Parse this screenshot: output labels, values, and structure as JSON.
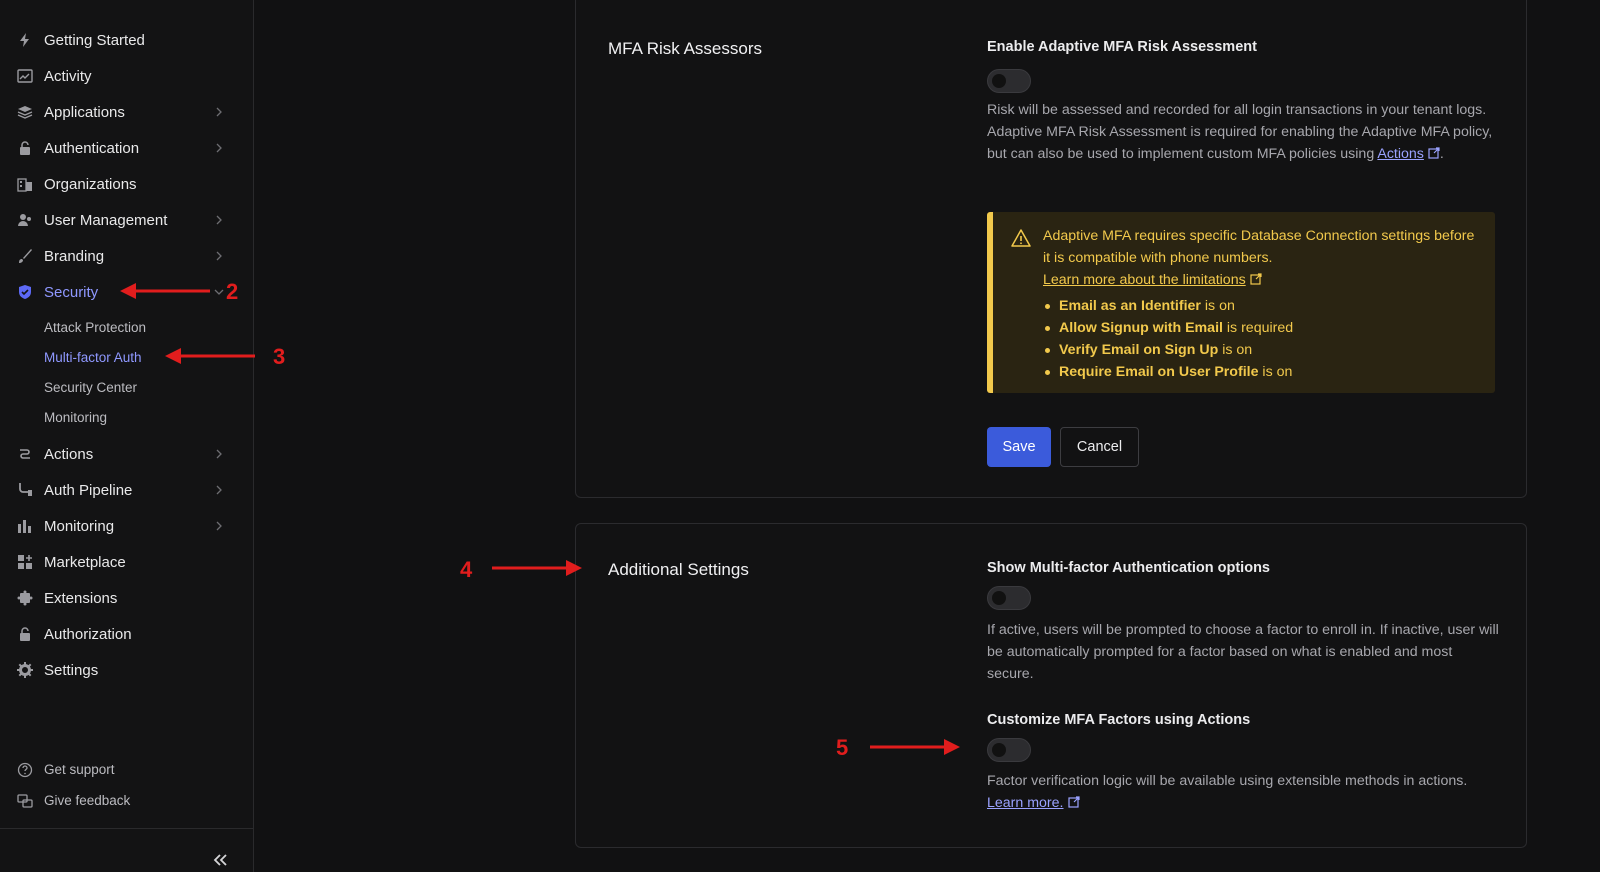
{
  "sidebar": {
    "items": [
      {
        "label": "Getting Started",
        "icon": "lightning-icon",
        "chevron": false
      },
      {
        "label": "Activity",
        "icon": "chart-line-icon",
        "chevron": false
      },
      {
        "label": "Applications",
        "icon": "layers-icon",
        "chevron": true
      },
      {
        "label": "Authentication",
        "icon": "lock-icon",
        "chevron": true
      },
      {
        "label": "Organizations",
        "icon": "building-icon",
        "chevron": false
      },
      {
        "label": "User Management",
        "icon": "users-icon",
        "chevron": true
      },
      {
        "label": "Branding",
        "icon": "brush-icon",
        "chevron": true
      },
      {
        "label": "Security",
        "icon": "shield-check-icon",
        "chevron": true,
        "active": true
      },
      {
        "label": "Actions",
        "icon": "actions-icon",
        "chevron": true
      },
      {
        "label": "Auth Pipeline",
        "icon": "pipeline-icon",
        "chevron": true
      },
      {
        "label": "Monitoring",
        "icon": "bar-chart-icon",
        "chevron": true
      },
      {
        "label": "Marketplace",
        "icon": "grid-plus-icon",
        "chevron": false
      },
      {
        "label": "Extensions",
        "icon": "puzzle-icon",
        "chevron": false
      },
      {
        "label": "Authorization",
        "icon": "lock-icon",
        "chevron": false
      },
      {
        "label": "Settings",
        "icon": "gear-icon",
        "chevron": false
      }
    ],
    "security_sub": [
      {
        "label": "Attack Protection"
      },
      {
        "label": "Multi-factor Auth",
        "active": true
      },
      {
        "label": "Security Center"
      },
      {
        "label": "Monitoring"
      }
    ],
    "bottom": [
      {
        "label": "Get support",
        "icon": "help-circle-icon"
      },
      {
        "label": "Give feedback",
        "icon": "feedback-icon"
      }
    ]
  },
  "risk_section": {
    "title": "MFA Risk Assessors",
    "toggle_label": "Enable Adaptive MFA Risk Assessment",
    "description": "Risk will be assessed and recorded for all login transactions in your tenant logs. Adaptive MFA Risk Assessment is required for enabling the Adaptive MFA policy, but can also be used to implement custom MFA policies using ",
    "link": "Actions",
    "alert": {
      "text": "Adaptive MFA requires specific Database Connection settings before it is compatible with phone numbers.",
      "link": "Learn more about the limitations",
      "items": [
        {
          "bold": "Email as an Identifier",
          "rest": " is on"
        },
        {
          "bold": "Allow Signup with Email",
          "rest": " is required"
        },
        {
          "bold": "Verify Email on Sign Up",
          "rest": " is on"
        },
        {
          "bold": "Require Email on User Profile",
          "rest": " is on"
        }
      ]
    },
    "save": "Save",
    "cancel": "Cancel"
  },
  "additional": {
    "title": "Additional Settings",
    "show_label": "Show Multi-factor Authentication options",
    "show_desc": "If active, users will be prompted to choose a factor to enroll in. If inactive, user will be automatically prompted for a factor based on what is enabled and most secure.",
    "customize_label": "Customize MFA Factors using Actions",
    "customize_desc": "Factor verification logic will be available using extensible methods in actions.",
    "customize_link": "Learn more."
  },
  "annotations": [
    "2",
    "3",
    "4",
    "5"
  ],
  "colors": {
    "accent": "#3b5bdb",
    "active_text": "#8f98ff",
    "warning": "#f2c94c",
    "annotation": "#e11d1d"
  }
}
